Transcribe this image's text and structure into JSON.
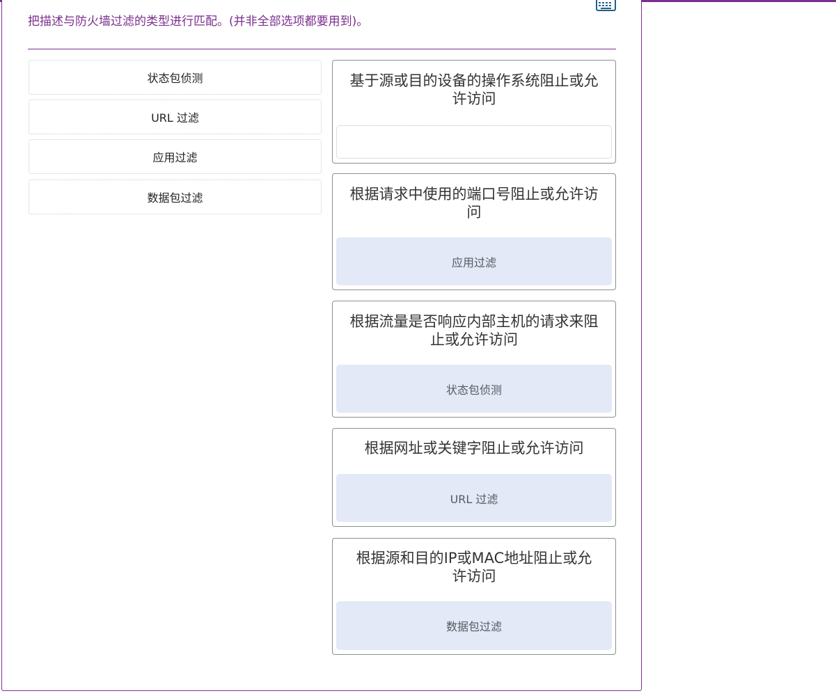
{
  "instruction": "把描述与防火墙过滤的类型进行匹配。(并非全部选项都要用到)。",
  "keyboard_icon": "keyboard-icon",
  "accent_color": "#7b2f8e",
  "options": [
    {
      "label": "状态包侦测"
    },
    {
      "label": "URL 过滤"
    },
    {
      "label": "应用过滤"
    },
    {
      "label": "数据包过滤"
    }
  ],
  "targets": [
    {
      "description": "基于源或目的设备的操作系统阻止或允许访问",
      "answer": ""
    },
    {
      "description": "根据请求中使用的端口号阻止或允许访问",
      "answer": "应用过滤"
    },
    {
      "description": "根据流量是否响应内部主机的请求来阻止或允许访问",
      "answer": "状态包侦测"
    },
    {
      "description": "根据网址或关键字阻止或允许访问",
      "answer": "URL 过滤"
    },
    {
      "description": "根据源和目的IP或MAC地址阻止或允许访问",
      "answer": "数据包过滤"
    }
  ]
}
